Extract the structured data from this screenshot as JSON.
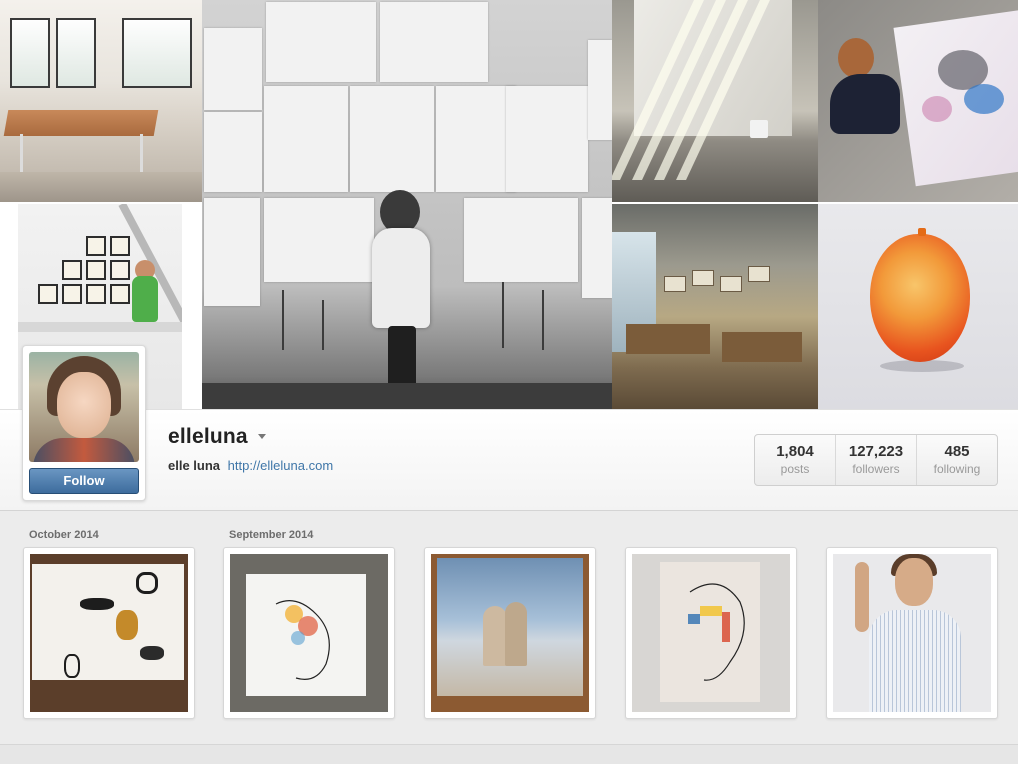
{
  "profile": {
    "username": "elleluna",
    "full_name": "elle luna",
    "website": "http://elleluna.com",
    "follow_label": "Follow",
    "stats": [
      {
        "value": "1,804",
        "label": "posts"
      },
      {
        "value": "127,223",
        "label": "followers"
      },
      {
        "value": "485",
        "label": "following"
      }
    ]
  },
  "timeline": {
    "months": [
      "October 2014",
      "September 2014"
    ]
  },
  "colors": {
    "follow_button": "#3d6c9d",
    "link": "#3f76a8"
  },
  "icons": {
    "username_caret": "chevron-down-icon"
  }
}
